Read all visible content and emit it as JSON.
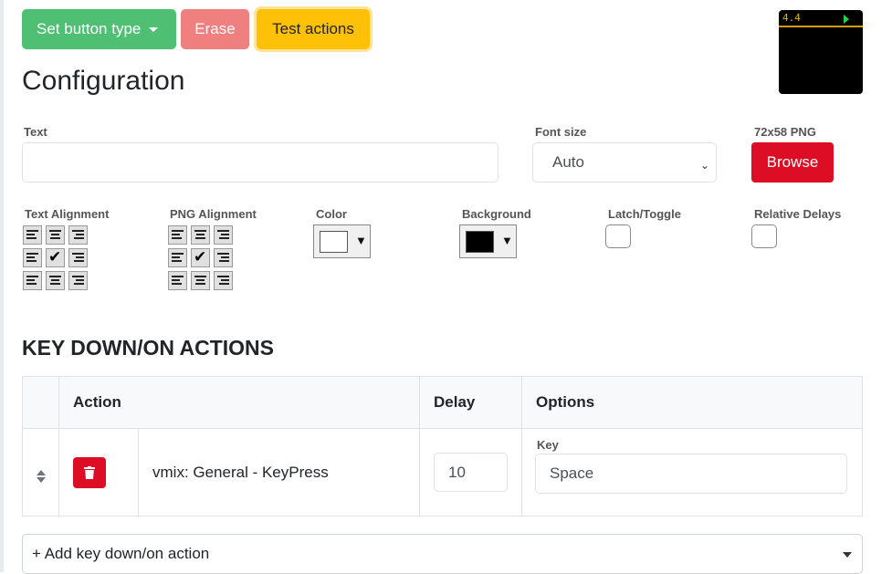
{
  "toolbar": {
    "set_type_label": "Set button type",
    "erase_label": "Erase",
    "test_label": "Test actions"
  },
  "preview": {
    "text": "4.4",
    "background": "#000000",
    "text_color": "#e0b000"
  },
  "config": {
    "heading": "Configuration",
    "text_label": "Text",
    "text_value": "",
    "font_size_label": "Font size",
    "font_size_value": "Auto",
    "png_label": "72x58 PNG",
    "browse_label": "Browse",
    "text_alignment_label": "Text Alignment",
    "text_alignment_selected": "middle-center",
    "png_alignment_label": "PNG Alignment",
    "png_alignment_selected": "middle-center",
    "color_label": "Color",
    "color_value": "#ffffff",
    "background_label": "Background",
    "background_value": "#000000",
    "latch_label": "Latch/Toggle",
    "latch_checked": false,
    "relative_delays_label": "Relative Delays",
    "relative_delays_checked": false
  },
  "actions": {
    "heading": "KEY DOWN/ON ACTIONS",
    "columns": [
      "Action",
      "Delay",
      "Options"
    ],
    "rows": [
      {
        "action": "vmix: General - KeyPress",
        "delay": "10",
        "option_label": "Key",
        "option_value": "Space"
      }
    ],
    "add_label": "+ Add key down/on action"
  }
}
